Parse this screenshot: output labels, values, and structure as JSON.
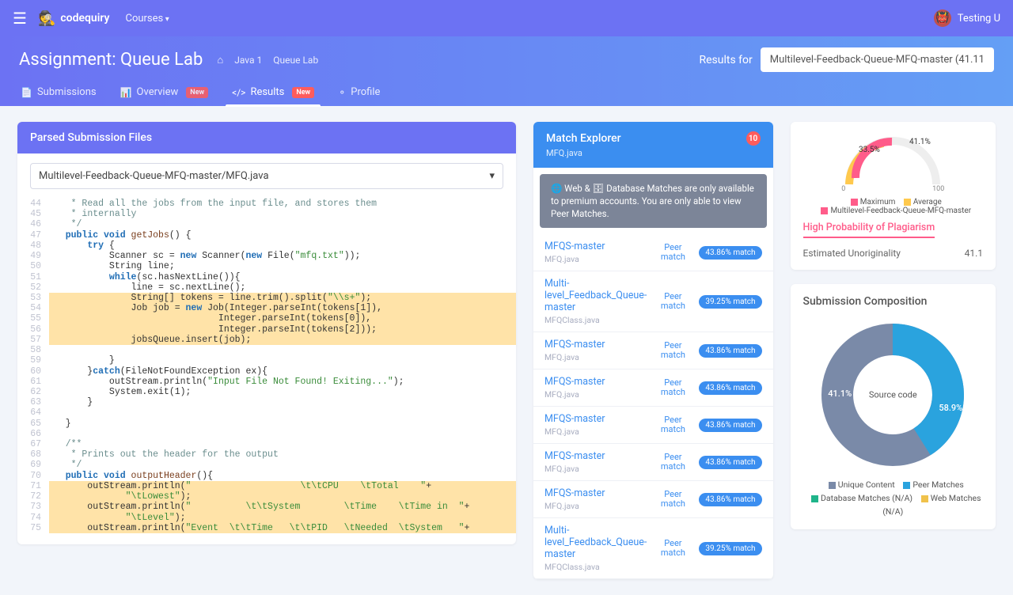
{
  "topbar": {
    "brand": "codequiry",
    "courses_label": "Courses",
    "user_name": "Testing U"
  },
  "header": {
    "title": "Assignment: Queue Lab",
    "crumbs": [
      "Java 1",
      "Queue Lab"
    ],
    "results_for_label": "Results for",
    "results_select": "Multilevel-Feedback-Queue-MFQ-master (41.11"
  },
  "tabs": {
    "submissions": "Submissions",
    "overview": "Overview",
    "results": "Results",
    "profile": "Profile",
    "new_badge": "New"
  },
  "parsed": {
    "title": "Parsed Submission Files",
    "file": "Multilevel-Feedback-Queue-MFQ-master/MFQ.java"
  },
  "code": [
    {
      "n": 44,
      "hl": false,
      "html": "    <span class='com'>* Read all the jobs from the input file, and stores them</span>"
    },
    {
      "n": 45,
      "hl": false,
      "html": "    <span class='com'>* internally</span>"
    },
    {
      "n": 46,
      "hl": false,
      "html": "    <span class='com'>*/</span>"
    },
    {
      "n": 47,
      "hl": false,
      "html": "   <span class='kw'>public void</span> <span class='fn'>getJobs</span>() {"
    },
    {
      "n": 48,
      "hl": false,
      "html": "       <span class='kw'>try</span> {"
    },
    {
      "n": 49,
      "hl": false,
      "html": "           Scanner sc = <span class='kw'>new</span> Scanner(<span class='kw'>new</span> File(<span class='str'>\"mfq.txt\"</span>));"
    },
    {
      "n": 50,
      "hl": false,
      "html": "           String line;"
    },
    {
      "n": 51,
      "hl": false,
      "html": "           <span class='kw'>while</span>(sc.hasNextLine()){"
    },
    {
      "n": 52,
      "hl": false,
      "html": "               line = sc.nextLine();"
    },
    {
      "n": 53,
      "hl": true,
      "html": "               String[] tokens = line.trim().split(<span class='str'>\"\\\\s+\"</span>);"
    },
    {
      "n": 54,
      "hl": true,
      "html": "               Job job = <span class='kw'>new</span> Job(Integer.parseInt(tokens[1]),"
    },
    {
      "n": 55,
      "hl": true,
      "html": "                               Integer.parseInt(tokens[0]),"
    },
    {
      "n": 56,
      "hl": true,
      "html": "                               Integer.parseInt(tokens[2]));"
    },
    {
      "n": 57,
      "hl": true,
      "html": "               jobsQueue.insert(job);"
    },
    {
      "n": 58,
      "hl": false,
      "html": ""
    },
    {
      "n": 59,
      "hl": false,
      "html": "           }"
    },
    {
      "n": 60,
      "hl": false,
      "html": "       }<span class='kw'>catch</span>(FileNotFoundException ex){"
    },
    {
      "n": 61,
      "hl": false,
      "html": "           outStream.println(<span class='str'>\"Input File Not Found! Exiting...\"</span>);"
    },
    {
      "n": 62,
      "hl": false,
      "html": "           System.exit(1);"
    },
    {
      "n": 63,
      "hl": false,
      "html": "       }"
    },
    {
      "n": 64,
      "hl": false,
      "html": ""
    },
    {
      "n": 65,
      "hl": false,
      "html": "   }"
    },
    {
      "n": 66,
      "hl": false,
      "html": ""
    },
    {
      "n": 67,
      "hl": false,
      "html": "   <span class='com'>/**</span>"
    },
    {
      "n": 68,
      "hl": false,
      "html": "   <span class='com'> * Prints out the header for the output</span>"
    },
    {
      "n": 69,
      "hl": false,
      "html": "   <span class='com'> */</span>"
    },
    {
      "n": 70,
      "hl": false,
      "html": "   <span class='kw'>public void</span> <span class='fn'>outputHeader</span>(){"
    },
    {
      "n": 71,
      "hl": true,
      "html": "       outStream.println(<span class='str'>\"                    \\t\\tCPU    \\tTotal    \"</span>+"
    },
    {
      "n": 72,
      "hl": true,
      "html": "              <span class='str'>\"\\tLowest\"</span>);"
    },
    {
      "n": 73,
      "hl": true,
      "html": "       outStream.println(<span class='str'>\"          \\t\\tSystem        \\tTime    \\tTime in  \"</span>+"
    },
    {
      "n": 74,
      "hl": true,
      "html": "              <span class='str'>\"\\tLevel\"</span>);"
    },
    {
      "n": 75,
      "hl": true,
      "html": "       outStream.println(<span class='str'>\"Event  \\t\\tTime   \\t\\tPID   \\tNeeded  \\tSystem   \"</span>+"
    }
  ],
  "match_explorer": {
    "title": "Match Explorer",
    "file": "MFQ.java",
    "count": "10",
    "premium_note": "🌐 Web & 🗄 Database Matches are only available to premium accounts. You are only able to view Peer Matches.",
    "peer_label": "Peer match",
    "matches": [
      {
        "name": "MFQS-master",
        "file": "MFQ.java",
        "pct": "43.86% match"
      },
      {
        "name": "Multi-level_Feedback_Queue-master",
        "file": "MFQClass.java",
        "pct": "39.25% match"
      },
      {
        "name": "MFQS-master",
        "file": "MFQ.java",
        "pct": "43.86% match"
      },
      {
        "name": "MFQS-master",
        "file": "MFQ.java",
        "pct": "43.86% match"
      },
      {
        "name": "MFQS-master",
        "file": "MFQ.java",
        "pct": "43.86% match"
      },
      {
        "name": "MFQS-master",
        "file": "MFQ.java",
        "pct": "43.86% match"
      },
      {
        "name": "MFQS-master",
        "file": "MFQ.java",
        "pct": "43.86% match"
      },
      {
        "name": "Multi-level_Feedback_Queue-master",
        "file": "MFQClass.java",
        "pct": "39.25% match"
      }
    ]
  },
  "gauge": {
    "pct_main": "41.1%",
    "pct_avg": "33.5%",
    "scale_min": "0",
    "scale_max": "100",
    "legend_max": "Maximum",
    "legend_avg": "Average",
    "legend_series": "Multilevel-Feedback-Queue-MFQ-master",
    "high_prob": "High Probability of Plagiarism",
    "est_label": "Estimated Unoriginality",
    "est_val": "41.1"
  },
  "composition": {
    "title": "Submission Composition",
    "center": "Source code",
    "pct_a": "41.1%",
    "pct_b": "58.9%",
    "legend": {
      "unique": "Unique Content",
      "peer": "Peer Matches",
      "db": "Database Matches (N/A)",
      "web": "Web Matches (N/A)"
    }
  },
  "chart_data": {
    "gauge": {
      "type": "gauge",
      "title": "Unoriginality",
      "range": [
        0,
        100
      ],
      "series": [
        {
          "name": "Maximum",
          "value": 41.1,
          "color": "#ff5c8a"
        },
        {
          "name": "Average",
          "value": 33.5,
          "color": "#ffc94d"
        }
      ],
      "submission": "Multilevel-Feedback-Queue-MFQ-master"
    },
    "composition_donut": {
      "type": "pie",
      "title": "Submission Composition",
      "center_label": "Source code",
      "series": [
        {
          "name": "Unique Content",
          "value": 58.9,
          "color": "#7a8aa8"
        },
        {
          "name": "Peer Matches",
          "value": 41.1,
          "color": "#2aa3de"
        },
        {
          "name": "Database Matches (N/A)",
          "value": 0,
          "color": "#1fb48a"
        },
        {
          "name": "Web Matches (N/A)",
          "value": 0,
          "color": "#f0c24b"
        }
      ]
    }
  }
}
